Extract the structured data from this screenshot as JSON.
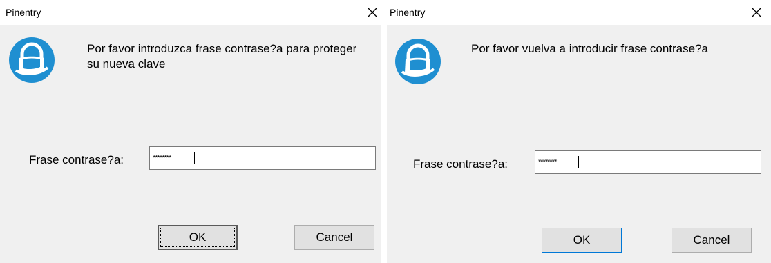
{
  "dialogs": [
    {
      "title": "Pinentry",
      "description": "Por favor introduzca frase contrase?a para proteger su nueva clave",
      "field_label": "Frase contrase?a:",
      "password_mask": "********",
      "ok_label": "OK",
      "cancel_label": "Cancel"
    },
    {
      "title": "Pinentry",
      "description": "Por favor vuelva a introducir frase contrase?a",
      "field_label": "Frase contrase?a:",
      "password_mask": "********",
      "ok_label": "OK",
      "cancel_label": "Cancel"
    }
  ],
  "colors": {
    "icon_blue": "#1f8fd1",
    "dialog_body": "#f0f0f0",
    "button_face": "#e1e1e1",
    "focus_blue": "#0078d7"
  },
  "icons": {
    "close": "close-icon",
    "lock": "padlock-icon"
  }
}
